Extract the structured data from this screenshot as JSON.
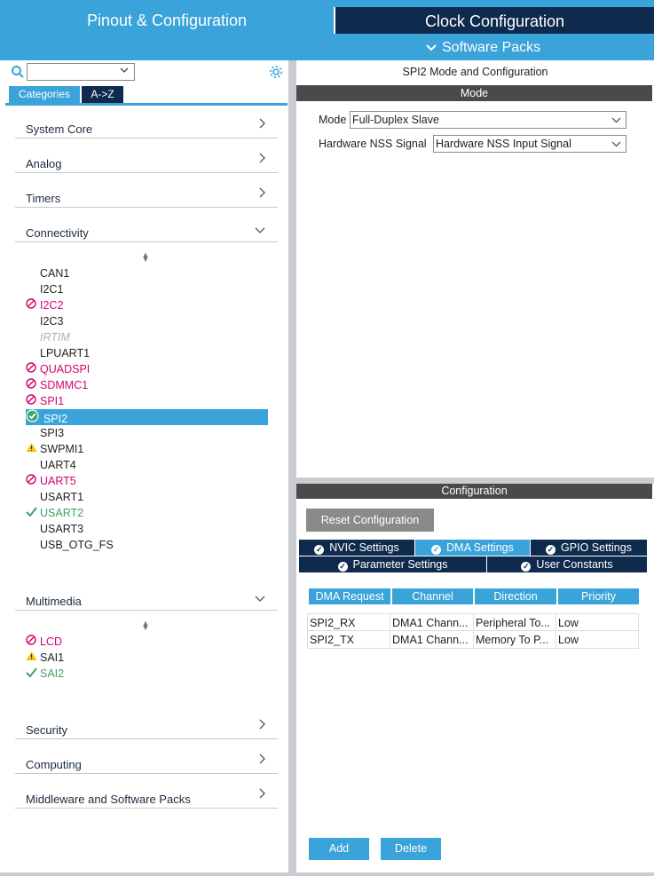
{
  "top_tabs": {
    "pinout": "Pinout & Configuration",
    "clock": "Clock Configuration"
  },
  "software_packs": "Software Packs",
  "left": {
    "search_value": "",
    "tabs": {
      "categories": "Categories",
      "az": "A->Z"
    },
    "categories": {
      "system_core": "System Core",
      "analog": "Analog",
      "timers": "Timers",
      "connectivity": "Connectivity",
      "multimedia": "Multimedia",
      "security": "Security",
      "computing": "Computing",
      "middleware": "Middleware and Software Packs"
    },
    "connectivity_items": [
      {
        "label": "CAN1",
        "status": "none"
      },
      {
        "label": "I2C1",
        "status": "none"
      },
      {
        "label": "I2C2",
        "status": "blocked"
      },
      {
        "label": "I2C3",
        "status": "none"
      },
      {
        "label": "IRTIM",
        "status": "disabled"
      },
      {
        "label": "LPUART1",
        "status": "none"
      },
      {
        "label": "QUADSPI",
        "status": "blocked"
      },
      {
        "label": "SDMMC1",
        "status": "blocked"
      },
      {
        "label": "SPI1",
        "status": "blocked"
      },
      {
        "label": "SPI2",
        "status": "selected"
      },
      {
        "label": "SPI3",
        "status": "none"
      },
      {
        "label": "SWPMI1",
        "status": "warning"
      },
      {
        "label": "UART4",
        "status": "none"
      },
      {
        "label": "UART5",
        "status": "blocked"
      },
      {
        "label": "USART1",
        "status": "none"
      },
      {
        "label": "USART2",
        "status": "ok"
      },
      {
        "label": "USART3",
        "status": "none"
      },
      {
        "label": "USB_OTG_FS",
        "status": "none"
      }
    ],
    "multimedia_items": [
      {
        "label": "LCD",
        "status": "blocked"
      },
      {
        "label": "SAI1",
        "status": "warning"
      },
      {
        "label": "SAI2",
        "status": "ok"
      }
    ]
  },
  "right": {
    "title": "SPI2 Mode and Configuration",
    "mode_header": "Mode",
    "mode_label": "Mode",
    "mode_value": "Full-Duplex Slave",
    "nss_label": "Hardware NSS Signal",
    "nss_value": "Hardware NSS Input Signal",
    "config_header": "Configuration",
    "reset_label": "Reset Configuration",
    "tabs": {
      "nvic": "NVIC Settings",
      "dma": "DMA Settings",
      "gpio": "GPIO Settings",
      "param": "Parameter Settings",
      "user": "User Constants"
    },
    "dma_table": {
      "headers": [
        "DMA Request",
        "Channel",
        "Direction",
        "Priority"
      ],
      "rows": [
        [
          "SPI2_RX",
          "DMA1 Chann...",
          "Peripheral To...",
          "Low"
        ],
        [
          "SPI2_TX",
          "DMA1 Chann...",
          "Memory To P...",
          "Low"
        ]
      ]
    },
    "add_label": "Add",
    "delete_label": "Delete"
  }
}
